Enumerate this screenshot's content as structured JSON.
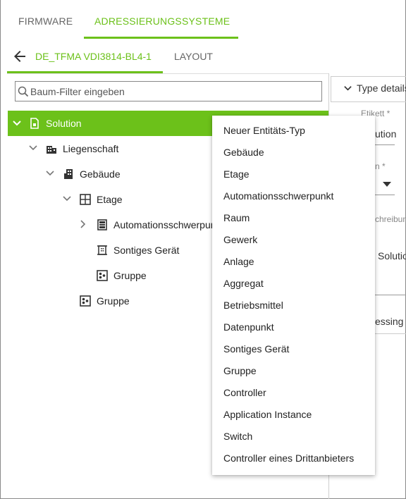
{
  "top_tabs": [
    {
      "label": "FIRMWARE"
    },
    {
      "label": "ADRESSIERUNGSSYSTEME"
    }
  ],
  "sub_tabs": [
    {
      "label": "DE_TFMA VDI3814-BL4-1"
    },
    {
      "label": "LAYOUT"
    }
  ],
  "search": {
    "placeholder": "Baum-Filter eingeben",
    "value": ""
  },
  "tree": {
    "solution": "Solution",
    "liegenschaft": "Liegenschaft",
    "gebaeude": "Gebäude",
    "etage": "Etage",
    "automationsschwerpunkt": "Automationsschwerpunkt",
    "sontiges_geraet": "Sontiges Gerät",
    "gruppe_child": "Gruppe",
    "gruppe": "Gruppe"
  },
  "right_panel": {
    "section_title": "Type details",
    "etikett_label": "Etikett *",
    "etikett_value": "ution",
    "field2_label": "n *",
    "beschreibung_label": "chreibun",
    "beschreibung_value": "Solutio",
    "addressing_value": "essing"
  },
  "context_menu": {
    "items": [
      "Neuer Entitäts-Typ",
      "Gebäude",
      "Etage",
      "Automationsschwerpunkt",
      "Raum",
      "Gewerk",
      "Anlage",
      "Aggregat",
      "Betriebsmittel",
      "Datenpunkt",
      "Sontiges Gerät",
      "Gruppe",
      "Controller",
      "Application Instance",
      "Switch",
      "Controller eines Drittanbieters"
    ]
  },
  "colors": {
    "accent": "#6cc11a",
    "text": "#222222",
    "muted": "#666666"
  },
  "icons": [
    "back-arrow-icon",
    "search-icon",
    "chevron-down-icon",
    "chevron-right-icon",
    "document-icon",
    "building-icon",
    "floor-icon",
    "cabinet-icon",
    "device-icon",
    "group-icon"
  ]
}
